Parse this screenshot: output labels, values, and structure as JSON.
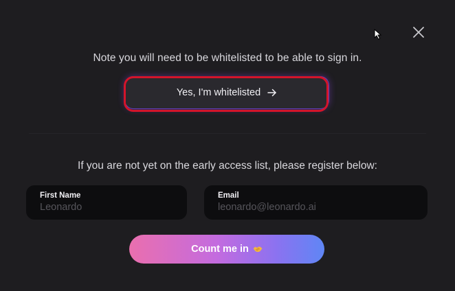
{
  "modal": {
    "note": "Note you will need to be whitelisted to be able to sign in.",
    "whitelist_button": {
      "label": "Yes, I'm whitelisted",
      "icon": "arrow-right-icon"
    },
    "register_note": "If you are not yet on the early access list, please register below:",
    "fields": {
      "first_name": {
        "label": "First Name",
        "placeholder": "Leonardo",
        "value": ""
      },
      "email": {
        "label": "Email",
        "placeholder": "leonardo@leonardo.ai",
        "value": ""
      }
    },
    "submit_button": {
      "label": "Count me in",
      "icon": "handshake-icon"
    },
    "close_icon": "close-icon"
  },
  "colors": {
    "background": "#1e1d20",
    "input_background": "#0d0d0f",
    "accent_glow": "#6a3fc4",
    "highlight_ring": "#d4142a",
    "gradient_start": "#ea6fae",
    "gradient_end": "#5f86f5"
  }
}
